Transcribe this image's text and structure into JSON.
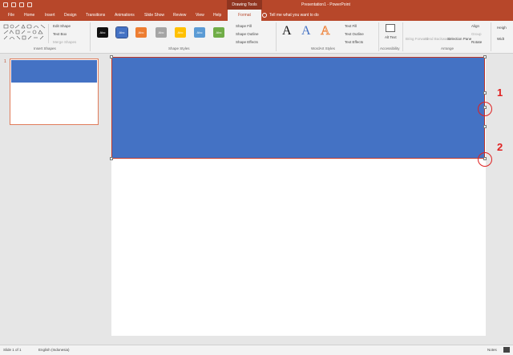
{
  "titlebar": {
    "drawing_tools": "Drawing Tools",
    "doc_title": "Presentation1 - PowerPoint"
  },
  "tabs": [
    "File",
    "Home",
    "Insert",
    "Design",
    "Transitions",
    "Animations",
    "Slide Show",
    "Review",
    "View",
    "Help"
  ],
  "active_tab": "Format",
  "tell_me": "Tell me what you want to do",
  "ribbon": {
    "insert_shapes": {
      "edit_shape": "Edit Shape",
      "text_box": "Text Box",
      "merge_shapes": "Merge Shapes",
      "label": "Insert Shapes"
    },
    "shape_styles": {
      "swatches": [
        {
          "text": "Abc",
          "color": "#111111"
        },
        {
          "text": "Abc",
          "color": "#4472c4"
        },
        {
          "text": "Abc",
          "color": "#ed7d31"
        },
        {
          "text": "Abc",
          "color": "#a5a5a5"
        },
        {
          "text": "Abc",
          "color": "#ffc000"
        },
        {
          "text": "Abc",
          "color": "#5b9bd5"
        },
        {
          "text": "Abc",
          "color": "#70ad47"
        }
      ],
      "fill": "Shape Fill",
      "outline": "Shape Outline",
      "effects": "Shape Effects",
      "label": "Shape Styles"
    },
    "wordart": {
      "letters": [
        "A",
        "A",
        "A"
      ],
      "text_fill": "Text Fill",
      "text_outline": "Text Outline",
      "text_effects": "Text Effects",
      "label": "WordArt Styles"
    },
    "accessibility": {
      "alt_text": "Alt Text",
      "label": "Accessibility"
    },
    "arrange": {
      "bring_forward": "Bring Forward",
      "send_backward": "Send Backward",
      "selection_pane": "Selection Pane",
      "align": "Align",
      "group": "Group",
      "rotate": "Rotate",
      "label": "Arrange"
    },
    "size": {
      "height": "Heigh",
      "width": "Widt"
    }
  },
  "slides_panel": {
    "slide_number": "1"
  },
  "annotations": [
    "1",
    "2"
  ],
  "statusbar": {
    "slide_info": "Slide 1 of 1",
    "language": "English (Indonesia)",
    "notes": "Notes"
  },
  "colors": {
    "brand": "#b7472a",
    "shape_fill": "#4472c4",
    "annotation": "#e02020"
  }
}
